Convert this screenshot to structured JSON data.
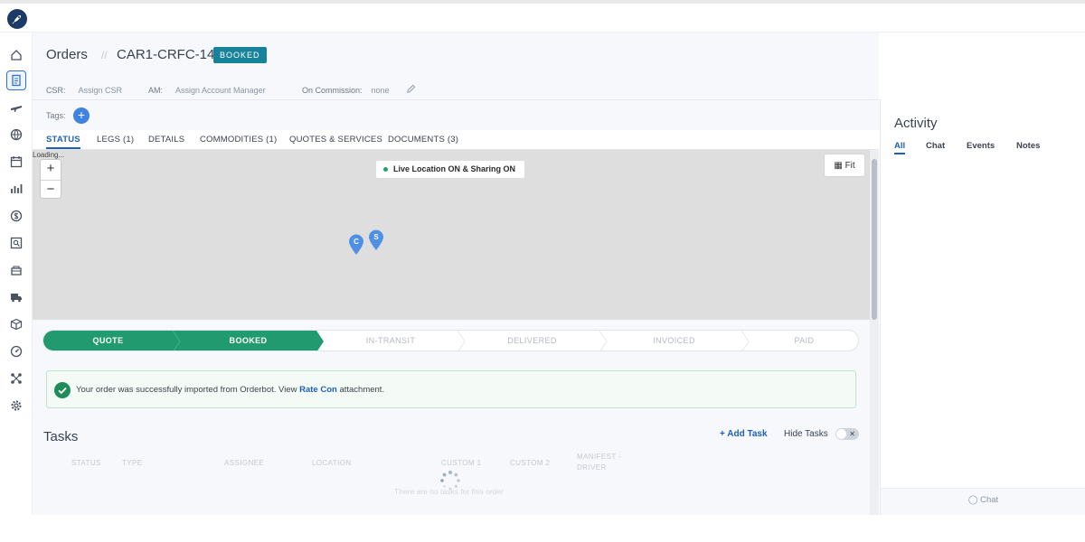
{
  "header": {
    "title": "Orders",
    "separator": "//",
    "order_id": "CAR1-CRFC-14",
    "status_badge": "BOOKED",
    "csr_label": "CSR:",
    "csr_value": "Assign CSR",
    "am_label": "AM:",
    "am_value": "Assign Account Manager",
    "commission_label": "On Commission:",
    "commission_value": "none"
  },
  "tags": {
    "label": "Tags:",
    "add_symbol": "+"
  },
  "tabs": [
    {
      "label": "STATUS"
    },
    {
      "label": "LEGS (1)"
    },
    {
      "label": "DETAILS"
    },
    {
      "label": "COMMODITIES (1)"
    },
    {
      "label": "QUOTES & SERVICES"
    },
    {
      "label": "DOCUMENTS (3)"
    }
  ],
  "map": {
    "loading_text": "Loading...",
    "zoom_in": "+",
    "zoom_out": "−",
    "live_status": "Live Location ON & Sharing ON",
    "fit_label": "Fit",
    "pins": [
      "C",
      "S"
    ]
  },
  "progress": {
    "steps": [
      {
        "label": "QUOTE",
        "done": true
      },
      {
        "label": "BOOKED",
        "done": true
      },
      {
        "label": "IN-TRANSIT",
        "done": false
      },
      {
        "label": "DELIVERED",
        "done": false
      },
      {
        "label": "INVOICED",
        "done": false
      },
      {
        "label": "PAID",
        "done": false
      }
    ]
  },
  "alert": {
    "text_before": "Your order was successfully imported from Orderbot. View ",
    "link": "Rate Con",
    "text_after": " attachment."
  },
  "tasks": {
    "title": "Tasks",
    "add_task": "+ Add Task",
    "hide_tasks": "Hide Tasks",
    "toggle_symbol": "✕",
    "columns": [
      "STATUS",
      "TYPE",
      "ASSIGNEE",
      "LOCATION",
      "CUSTOM 1",
      "CUSTOM 2",
      "MANIFEST -",
      "DRIVER"
    ],
    "empty_text": "There are no tasks for this order"
  },
  "activity": {
    "title": "Activity",
    "tabs": [
      "All",
      "Chat",
      "Events",
      "Notes"
    ],
    "footer": "Chat"
  },
  "colors": {
    "accent": "#1f5fb8",
    "badge": "#16839b",
    "progress_done": "#229a6f",
    "success": "#1f8b5a"
  }
}
